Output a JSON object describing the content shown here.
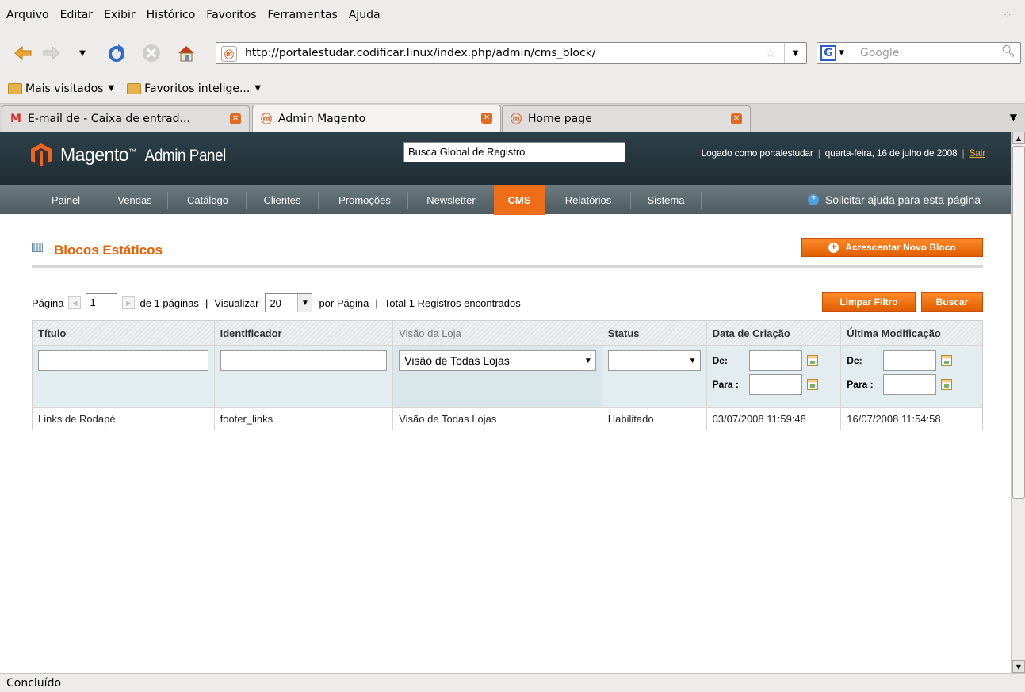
{
  "menubar": {
    "items": [
      {
        "label": "Arquivo"
      },
      {
        "label": "Editar"
      },
      {
        "label": "Exibir"
      },
      {
        "label": "Histórico"
      },
      {
        "label": "Favoritos"
      },
      {
        "label": "Ferramentas"
      },
      {
        "label": "Ajuda"
      }
    ]
  },
  "navbar": {
    "url": "http://portalestudar.codificar.linux/index.php/admin/cms_block/",
    "search_placeholder": "Google"
  },
  "bookmarks": {
    "most_visited": "Mais visitados",
    "smart_bookmarks": "Favoritos intelige..."
  },
  "tabs": [
    {
      "label": "E-mail de  - Caixa de entrad...",
      "active": false
    },
    {
      "label": "Admin Magento",
      "active": true
    },
    {
      "label": "Home page",
      "active": false
    }
  ],
  "admin": {
    "logo_brand": "Magento",
    "logo_tm": "™",
    "logo_suffix": "Admin Panel",
    "global_search_value": "Busca Global de Registro",
    "user_text": "Logado como portalestudar",
    "date_text": "quarta-feira, 16 de julho de 2008",
    "logout_label": "Sair",
    "nav": [
      {
        "label": "Painel",
        "active": false
      },
      {
        "label": "Vendas",
        "active": false
      },
      {
        "label": "Catálogo",
        "active": false
      },
      {
        "label": "Clientes",
        "active": false
      },
      {
        "label": "Promoções",
        "active": false
      },
      {
        "label": "Newsletter",
        "active": false
      },
      {
        "label": "CMS",
        "active": true
      },
      {
        "label": "Relatórios",
        "active": false
      },
      {
        "label": "Sistema",
        "active": false
      }
    ],
    "help_label": "Solicitar ajuda para esta página"
  },
  "page": {
    "title": "Blocos Estáticos",
    "add_button": "Acrescentar Novo Bloco",
    "pager": {
      "page_label": "Página",
      "page_value": "1",
      "of_pages": "de 1 páginas",
      "sep1": "|",
      "view_label": "Visualizar",
      "per_page_value": "20",
      "per_page_label": "por Página",
      "sep2": "|",
      "total_label": "Total 1 Registros encontrados"
    },
    "reset_button": "Limpar Filtro",
    "search_button": "Buscar"
  },
  "grid": {
    "columns": [
      "Título",
      "Identificador",
      "Visão da Loja",
      "Status",
      "Data de Criação",
      "Última Modificação"
    ],
    "filter": {
      "store_view_value": "Visão de Todas Lojas",
      "status_value": "",
      "from_label": "De:",
      "to_label": "Para :"
    },
    "rows": [
      {
        "title": "Links de Rodapé",
        "identifier": "footer_links",
        "store_view": "Visão de Todas Lojas",
        "status": "Habilitado",
        "created": "03/07/2008 11:59:48",
        "modified": "16/07/2008 11:54:58"
      }
    ]
  },
  "statusbar": {
    "text": "Concluído"
  }
}
